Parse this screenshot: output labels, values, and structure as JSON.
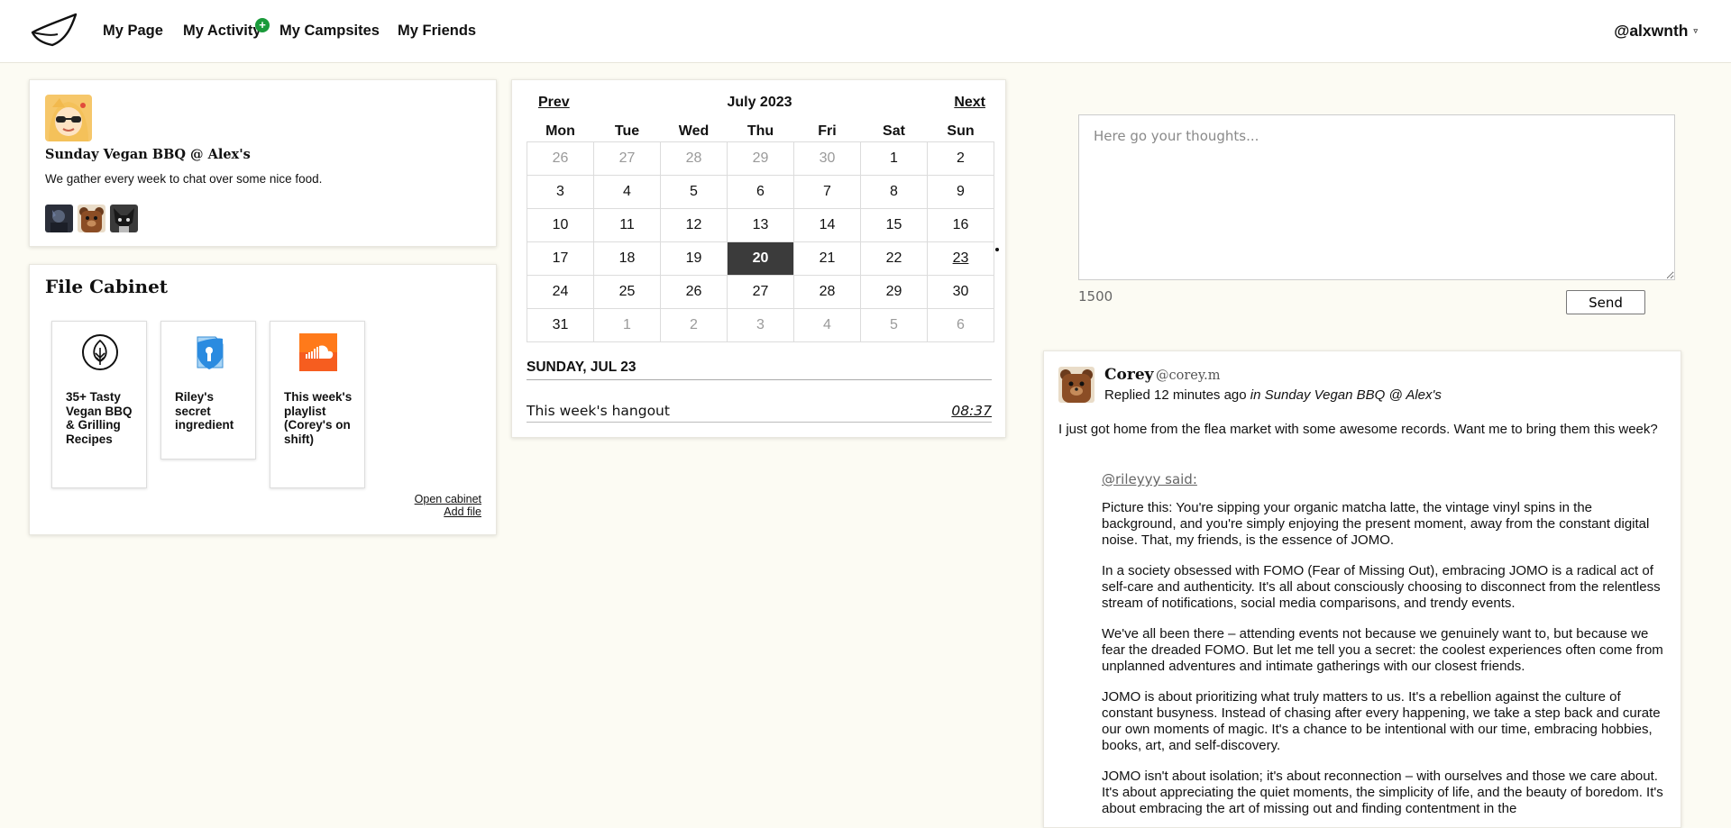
{
  "nav": {
    "links": [
      "My Page",
      "My Activity",
      "My Campsites",
      "My Friends"
    ],
    "activity_badge": "+",
    "username": "@alxwnth",
    "caret": "▿"
  },
  "group": {
    "title": "Sunday Vegan BBQ @ Alex's",
    "description": "We gather every week to chat over some nice food."
  },
  "cabinet": {
    "title": "File Cabinet",
    "files": [
      {
        "name": "35+ Tasty Vegan BBQ & Grilling Recipes",
        "icon": "leaf-icon"
      },
      {
        "name": "Riley's secret ingredient",
        "icon": "secure-doc-icon"
      },
      {
        "name": "This week's playlist (Corey's on shift)",
        "icon": "soundcloud-icon"
      }
    ],
    "open_label": "Open cabinet",
    "add_label": "Add file"
  },
  "calendar": {
    "prev": "Prev",
    "next": "Next",
    "month": "July 2023",
    "weekdays": [
      "Mon",
      "Tue",
      "Wed",
      "Thu",
      "Fri",
      "Sat",
      "Sun"
    ],
    "weeks": [
      [
        "26",
        "27",
        "28",
        "29",
        "30",
        "1",
        "2"
      ],
      [
        "3",
        "4",
        "5",
        "6",
        "7",
        "8",
        "9"
      ],
      [
        "10",
        "11",
        "12",
        "13",
        "14",
        "15",
        "16"
      ],
      [
        "17",
        "18",
        "19",
        "20",
        "21",
        "22",
        "23"
      ],
      [
        "24",
        "25",
        "26",
        "27",
        "28",
        "29",
        "30"
      ],
      [
        "31",
        "1",
        "2",
        "3",
        "4",
        "5",
        "6"
      ]
    ],
    "today": "20",
    "event_day": "23",
    "selected_heading": "SUNDAY, JUL 23",
    "event": {
      "title": "This week's hangout",
      "time": "08:37"
    }
  },
  "compose": {
    "placeholder": "Here go your thoughts...",
    "char_count": "1500",
    "send_label": "Send"
  },
  "post": {
    "author": "Corey",
    "handle": "@corey.m",
    "meta_prefix": "Replied 12 minutes ago",
    "meta_in": "in Sunday Vegan BBQ @ Alex's",
    "body": "I just got home from the flea market with some awesome records. Want me to bring them this week?",
    "quote_author": "@rileyyy said:",
    "quote_paragraphs": [
      "Picture this: You're sipping your organic matcha latte, the vintage vinyl spins in the background, and you're simply enjoying the present moment, away from the constant digital noise. That, my friends, is the essence of JOMO.",
      "In a society obsessed with FOMO (Fear of Missing Out), embracing JOMO is a radical act of self-care and authenticity. It's all about consciously choosing to disconnect from the relentless stream of notifications, social media comparisons, and trendy events.",
      "We've all been there – attending events not because we genuinely want to, but because we fear the dreaded FOMO. But let me tell you a secret: the coolest experiences often come from unplanned adventures and intimate gatherings with our closest friends.",
      "JOMO is about prioritizing what truly matters to us. It's a rebellion against the culture of constant busyness. Instead of chasing after every happening, we take a step back and curate our own moments of magic. It's a chance to be intentional with our time, embracing hobbies, books, art, and self-discovery.",
      "JOMO isn't about isolation; it's about reconnection – with ourselves and those we care about. It's about appreciating the quiet moments, the simplicity of life, and the beauty of boredom. It's about embracing the art of missing out and finding contentment in the"
    ]
  }
}
